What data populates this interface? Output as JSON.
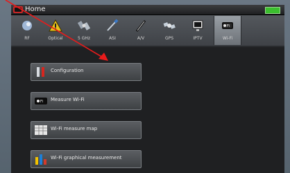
{
  "window": {
    "title": "Home"
  },
  "tabs": [
    {
      "label": "RF",
      "icon": "satellite-dish-icon"
    },
    {
      "label": "Optical",
      "icon": "warning-triangle-icon"
    },
    {
      "label": "5 GHz",
      "icon": "satellite-icon"
    },
    {
      "label": "ASI",
      "icon": "cable-plug-icon"
    },
    {
      "label": "A/V",
      "icon": "av-cable-icon"
    },
    {
      "label": "GPS",
      "icon": "gps-satellite-icon"
    },
    {
      "label": "IPTV",
      "icon": "monitor-icon"
    },
    {
      "label": "Wi-Fi",
      "icon": "wifi-icon"
    }
  ],
  "menu": [
    {
      "label": "Configuration",
      "icon": "wrench-icon"
    },
    {
      "label": "Measure Wi-Fi",
      "icon": "wifi-icon"
    },
    {
      "label": "Wi-Fi measure map",
      "icon": "table-map-icon"
    },
    {
      "label": "Wi-Fi graphical measurement",
      "icon": "bar-chart-icon"
    }
  ],
  "colors": {
    "battery": "#3bbf2e",
    "logo": "#c62626",
    "pointer": "#e81b1b"
  }
}
